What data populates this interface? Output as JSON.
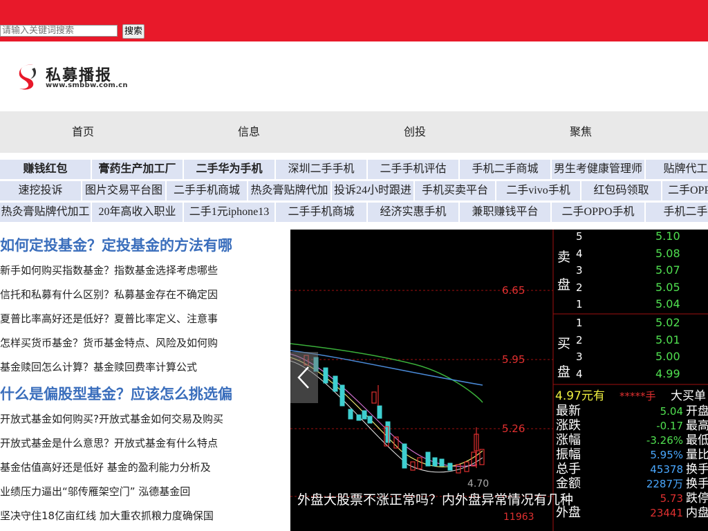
{
  "search": {
    "placeholder": "请输入关键词搜索",
    "button_label": "搜索"
  },
  "logo": {
    "name": "私募播报",
    "url": "www.smbbw.com.cn"
  },
  "main_nav": [
    "首页",
    "信息",
    "创投",
    "聚焦"
  ],
  "keyword_rows": [
    [
      {
        "label": "赚钱红包",
        "bold": true
      },
      {
        "label": "膏药生产加工厂",
        "bold": true
      },
      {
        "label": "二手华为手机",
        "bold": true
      },
      {
        "label": "深圳二手手机",
        "bold": false
      },
      {
        "label": "二手手机评估",
        "bold": false
      },
      {
        "label": "手机二手商城",
        "bold": false
      },
      {
        "label": "男生考健康管理师",
        "bold": false
      },
      {
        "label": "贴牌代工膏",
        "bold": false
      }
    ],
    [
      {
        "label": "速挖投诉",
        "bold": false
      },
      {
        "label": "图片交易平台图",
        "bold": false
      },
      {
        "label": "二手手机商城",
        "bold": false
      },
      {
        "label": "热灸膏贴牌代加",
        "bold": false
      },
      {
        "label": "投诉24小时跟进",
        "bold": false
      },
      {
        "label": "手机买卖平台",
        "bold": false
      },
      {
        "label": "二手vivo手机",
        "bold": false
      },
      {
        "label": "红包码领取",
        "bold": false
      },
      {
        "label": "二手OPP",
        "bold": false
      }
    ],
    [
      {
        "label": "热灸膏贴牌代加工",
        "bold": false
      },
      {
        "label": "20年高收入职业",
        "bold": false
      },
      {
        "label": "二手1元iphone13",
        "bold": false
      },
      {
        "label": "二手手机商城",
        "bold": false
      },
      {
        "label": "经济实惠手机",
        "bold": false
      },
      {
        "label": "兼职赚钱平台",
        "bold": false
      },
      {
        "label": "二手OPPO手机",
        "bold": false
      },
      {
        "label": "手机二手市",
        "bold": false
      }
    ]
  ],
  "articles": [
    {
      "type": "title",
      "text": "如何定投基金？定投基金的方法有哪"
    },
    {
      "type": "item",
      "text": "新手如何购买指数基金？指数基金选择考虑哪些"
    },
    {
      "type": "item",
      "text": "信托和私募有什么区别？私募基金存在不确定因"
    },
    {
      "type": "item",
      "text": "夏普比率高好还是低好？夏普比率定义、注意事"
    },
    {
      "type": "item",
      "text": "怎样买货币基金？货币基金特点、风险及如何购"
    },
    {
      "type": "item",
      "text": "基金赎回怎么计算？基金赎回费率计算公式"
    },
    {
      "type": "title",
      "text": "什么是偏股型基金？应该怎么挑选偏"
    },
    {
      "type": "item",
      "text": "开放式基金如何购买?开放式基金如何交易及购买"
    },
    {
      "type": "item",
      "text": "开放式基金是什么意思？开放式基金有什么特点"
    },
    {
      "type": "item",
      "text": "基金估值高好还是低好 基金的盈利能力分析及"
    },
    {
      "type": "item",
      "text": "业绩压力逼出“邬传雁架空门” 泓德基金回"
    },
    {
      "type": "item",
      "text": "坚决守住18亿亩红线 加大重农抓粮力度确保国"
    }
  ],
  "slider": {
    "caption": "外盘大股票不涨正常吗？内外盘异常情况有几种",
    "chart_prices": [
      "6.65",
      "5.95",
      "5.26",
      "4.70",
      "11963"
    ],
    "sell_label": "卖盘",
    "buy_label": "买盘",
    "sell_levels": [
      {
        "level": "5",
        "price": "5.10"
      },
      {
        "level": "4",
        "price": "5.08"
      },
      {
        "level": "3",
        "price": "5.07"
      },
      {
        "level": "2",
        "price": "5.05"
      },
      {
        "level": "1",
        "price": "5.04"
      }
    ],
    "buy_levels": [
      {
        "level": "1",
        "price": "5.02"
      },
      {
        "level": "2",
        "price": "5.01"
      },
      {
        "level": "3",
        "price": "5.00"
      },
      {
        "level": "4",
        "price": "4.99"
      }
    ],
    "trade_line": {
      "price": "4.97元有",
      "vol": "*****手",
      "tail": "大买单"
    },
    "stats": [
      {
        "label": "最新",
        "value": "5.04",
        "tail": "开盘"
      },
      {
        "label": "涨跌",
        "value": "-0.17",
        "tail": "最高"
      },
      {
        "label": "涨幅",
        "value": "-3.26%",
        "tail": "最低"
      },
      {
        "label": "振幅",
        "value": "5.95%",
        "tail": "量比"
      },
      {
        "label": "总手",
        "value": "45378",
        "tail": "换手"
      },
      {
        "label": "金额",
        "value": "2287万",
        "tail": "换手"
      },
      {
        "label": "",
        "value": "5.73",
        "tail": "跌停"
      },
      {
        "label": "外盘",
        "value": "23441",
        "tail": "内盘"
      }
    ]
  },
  "colors": {
    "brand_red": "#e8192a",
    "nav_bg": "#e9e9e9",
    "keyword_bg": "#dde3f3",
    "title_blue": "#3a6ebc"
  }
}
